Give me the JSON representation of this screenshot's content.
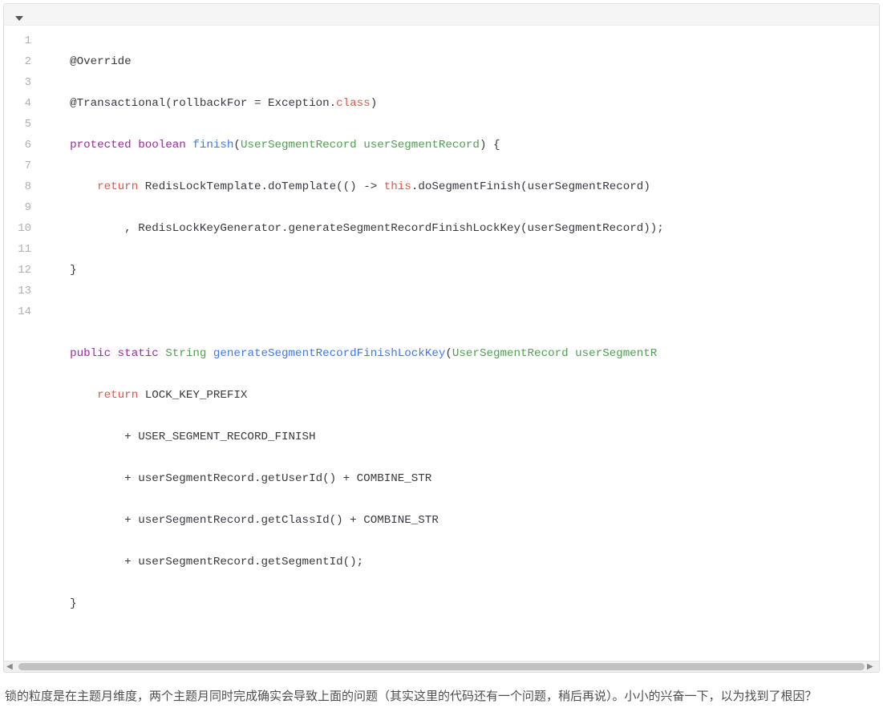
{
  "code": {
    "lines": [
      {
        "n": "1"
      },
      {
        "n": "2"
      },
      {
        "n": "3"
      },
      {
        "n": "4"
      },
      {
        "n": "5"
      },
      {
        "n": "6"
      },
      {
        "n": "7"
      },
      {
        "n": "8"
      },
      {
        "n": "9"
      },
      {
        "n": "10"
      },
      {
        "n": "11"
      },
      {
        "n": "12"
      },
      {
        "n": "13"
      },
      {
        "n": "14"
      }
    ],
    "tokens": {
      "l1_override": "@Override",
      "l2_transactional": "@Transactional",
      "l2_rollbackFor": "rollbackFor",
      "l2_eq": " = ",
      "l2_exception": "Exception",
      "l2_dot": ".",
      "l2_class": "class",
      "l3_protected": "protected",
      "l3_boolean": "boolean",
      "l3_finish": "finish",
      "l3_UserSegmentRecord": "UserSegmentRecord",
      "l3_userSegmentRecord": "userSegmentRecord",
      "l4_return": "return",
      "l4_RedisLockTemplate": "RedisLockTemplate",
      "l4_doTemplate": "doTemplate",
      "l4_this": "this",
      "l4_doSegmentFinish": "doSegmentFinish",
      "l4_userSegmentRecord": "userSegmentRecord",
      "l5_comma": ", ",
      "l5_RedisLockKeyGenerator": "RedisLockKeyGenerator",
      "l5_generate": "generateSegmentRecordFinishLockKey",
      "l5_userSegmentRecord": "userSegmentRecord",
      "l6_brace": "}",
      "l8_public": "public",
      "l8_static": "static",
      "l8_String": "String",
      "l8_generate": "generateSegmentRecordFinishLockKey",
      "l8_UserSegmentRecord": "UserSegmentRecord",
      "l8_userSegmentRecord": "userSegmentR",
      "l9_return": "return",
      "l9_LOCK": "LOCK_KEY_PREFIX",
      "l10_plus": "+ ",
      "l10_USER": "USER_SEGMENT_RECORD_FINISH",
      "l11_usr": "userSegmentRecord",
      "l11_getUserId": "getUserId",
      "l11_combine": "COMBINE_STR",
      "l12_usr": "userSegmentRecord",
      "l12_getClassId": "getClassId",
      "l12_combine": "COMBINE_STR",
      "l13_usr": "userSegmentRecord",
      "l13_getSegmentId": "getSegmentId",
      "l14_brace": "}"
    }
  },
  "article": {
    "paragraph": "锁的粒度是在主题月维度，两个主题月同时完成确实会导致上面的问题（其实这里的代码还有一个问题，稍后再说）。小小的兴奋一下，以为找到了根因？"
  }
}
